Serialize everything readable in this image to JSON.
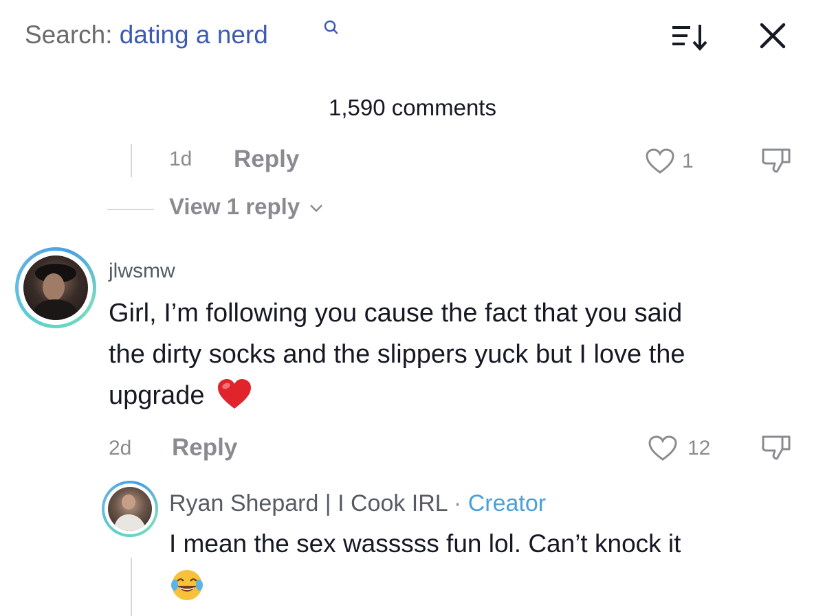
{
  "search": {
    "label": "Search:",
    "term": "dating a nerd",
    "icon": "search-icon"
  },
  "header": {
    "comments_count": "1,590 comments",
    "sort_icon": "sort-icon",
    "close_icon": "close-icon"
  },
  "comments": [
    {
      "time": "1d",
      "reply_label": "Reply",
      "likes": "1",
      "view_replies": "View 1 reply"
    },
    {
      "username": "jlwsmw",
      "text": "Girl, I’m following you cause the fact that you said the dirty socks and the slippers yuck but I love the upgrade",
      "line1": "Girl, I’m following you cause the fact that you said",
      "line2": "the dirty socks and the slippers yuck but I love the",
      "line3": "upgrade",
      "emoji": "❤️",
      "time": "2d",
      "reply_label": "Reply",
      "likes": "12",
      "reply": {
        "username": "Ryan Shepard | I Cook IRL",
        "separator": "·",
        "badge": "Creator",
        "text": "I mean the sex wasssss fun lol. Can’t knock it",
        "emoji": "😂"
      }
    }
  ],
  "colors": {
    "link_blue": "#3b5bb3",
    "creator_blue": "#4a9fd8",
    "muted": "#8a8b91",
    "text": "#161823",
    "heart_red": "#e0242c"
  }
}
